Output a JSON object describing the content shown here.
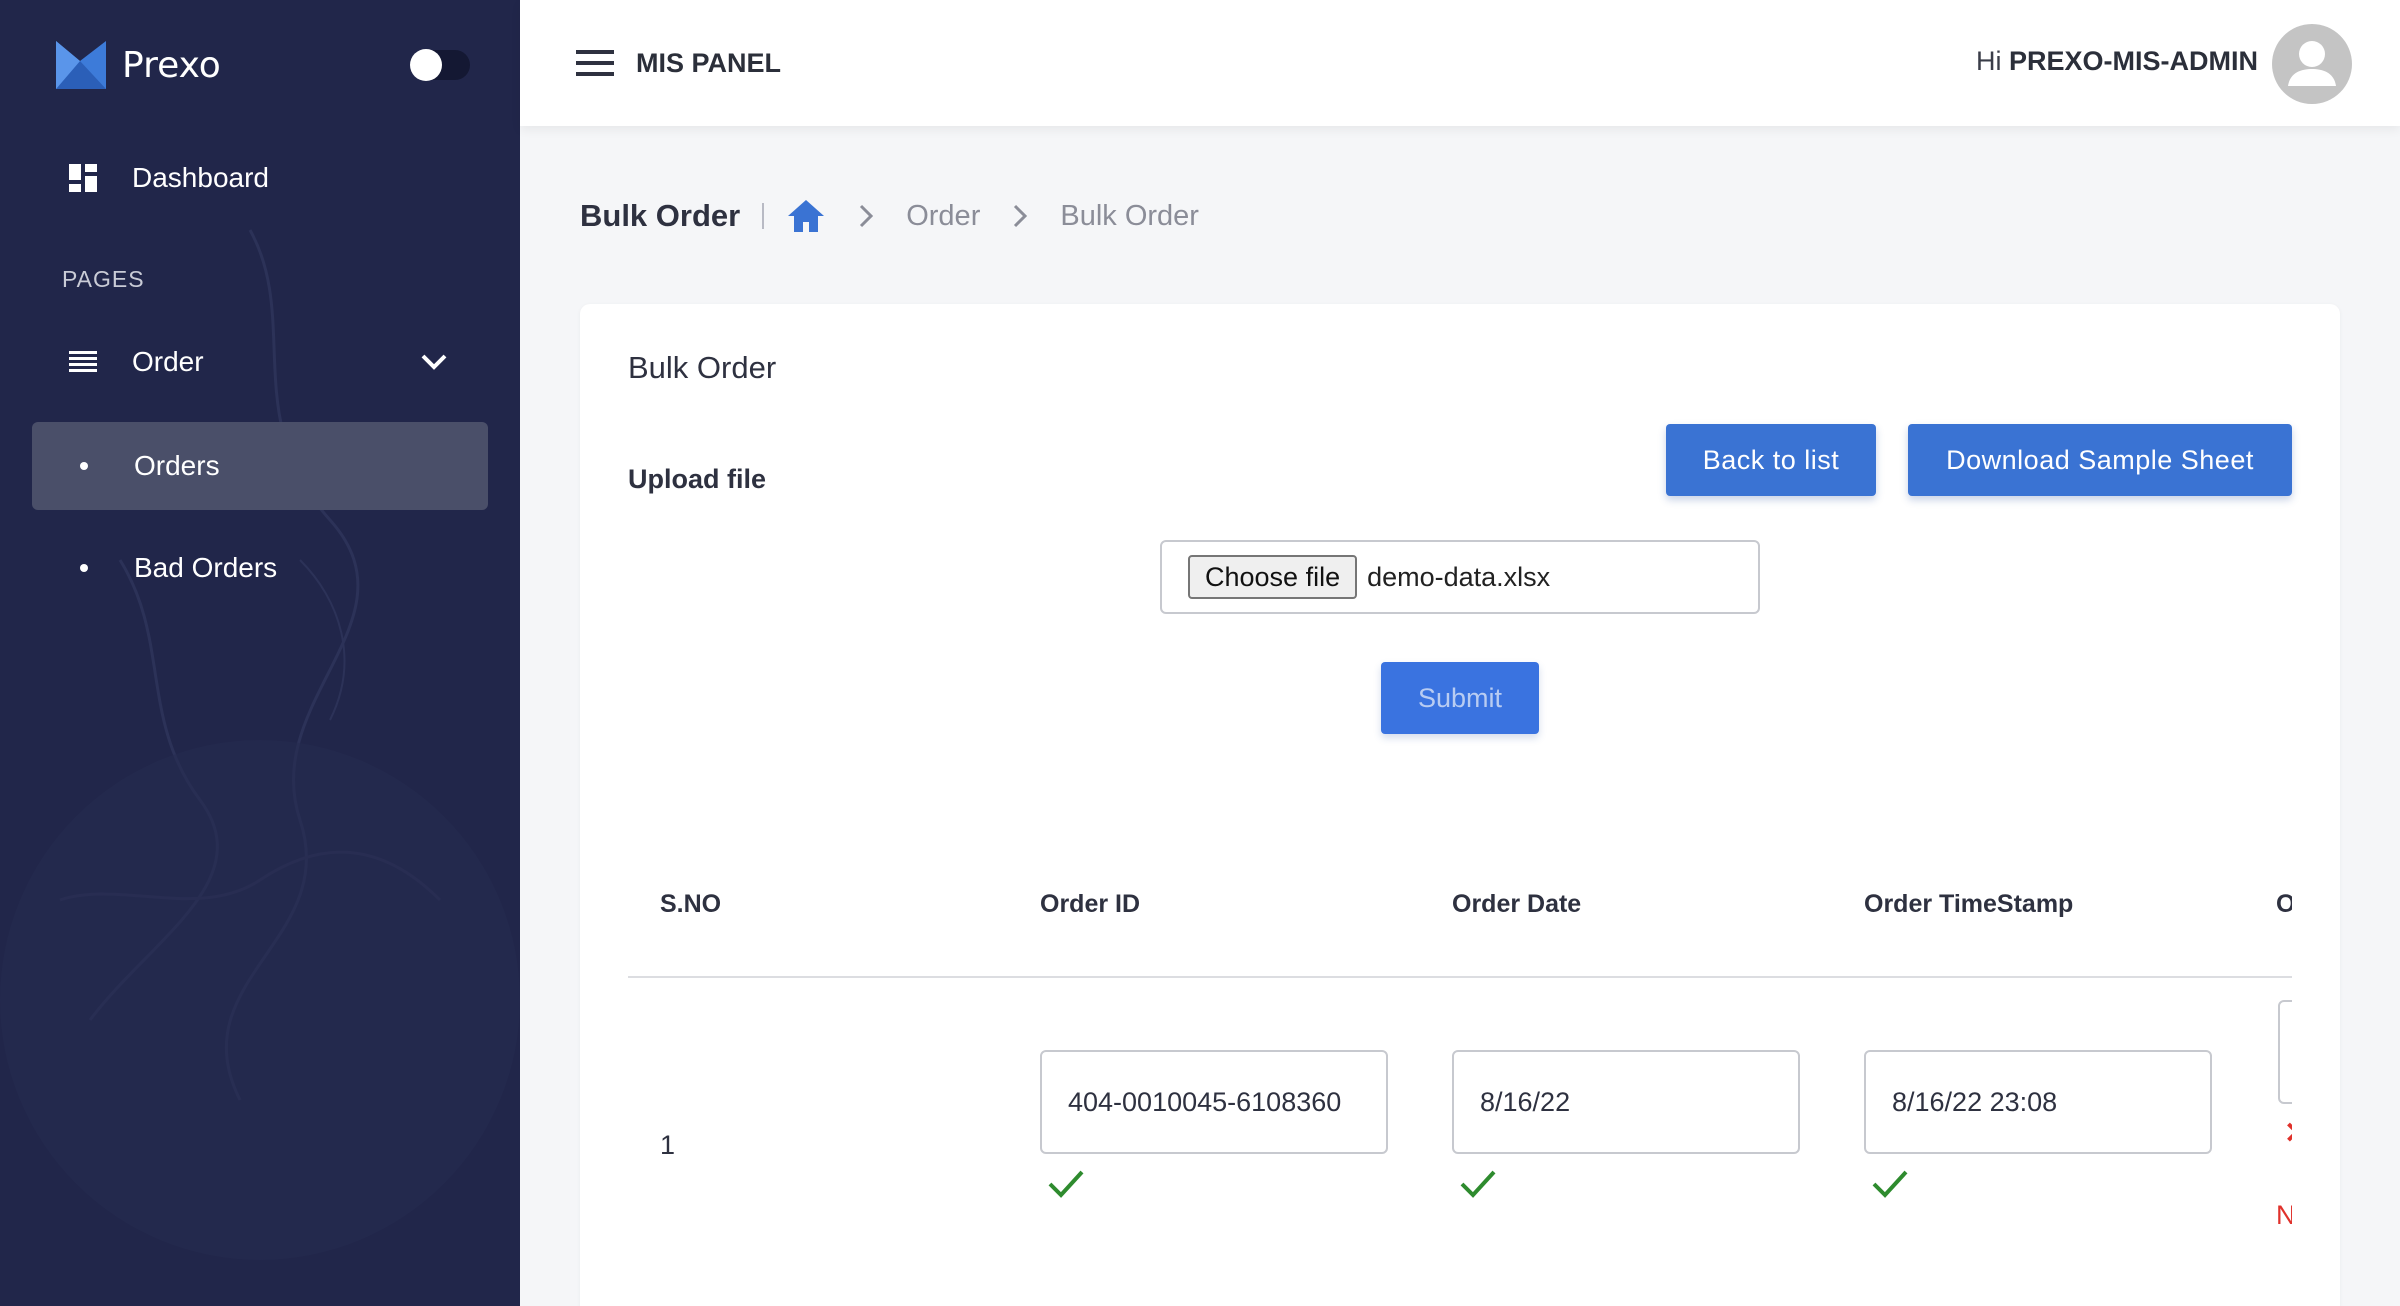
{
  "sidebar": {
    "brand": "Prexo",
    "section_label": "PAGES",
    "items": [
      {
        "label": "Dashboard",
        "icon": "dashboard-icon"
      },
      {
        "label": "Order",
        "icon": "list-icon"
      },
      {
        "label": "Orders",
        "icon": "bullet"
      },
      {
        "label": "Bad Orders",
        "icon": "bullet"
      }
    ]
  },
  "topbar": {
    "title": "MIS PANEL",
    "greeting_prefix": "Hi",
    "username": "PREXO-MIS-ADMIN"
  },
  "breadcrumb": {
    "title": "Bulk Order",
    "items": [
      "Order",
      "Bulk Order"
    ]
  },
  "card": {
    "title": "Bulk Order",
    "upload_label": "Upload file",
    "back_button": "Back to list",
    "download_button": "Download Sample Sheet",
    "choose_file_button": "Choose file",
    "file_name": "demo-data.xlsx",
    "submit_button": "Submit"
  },
  "table": {
    "headers": [
      "S.NO",
      "Order ID",
      "Order Date",
      "Order TimeStamp",
      "O"
    ],
    "rows": [
      {
        "sno": "1",
        "order_id": "404-0010045-6108360",
        "order_date": "8/16/22",
        "order_timestamp": "8/16/22 23:08",
        "partial_error": "N"
      }
    ]
  },
  "colors": {
    "sidebar_bg": "#21264a",
    "active_item_bg": "#4a4f69",
    "primary": "#3a73d3",
    "success": "#2e8b2e",
    "error": "#e0312b"
  }
}
